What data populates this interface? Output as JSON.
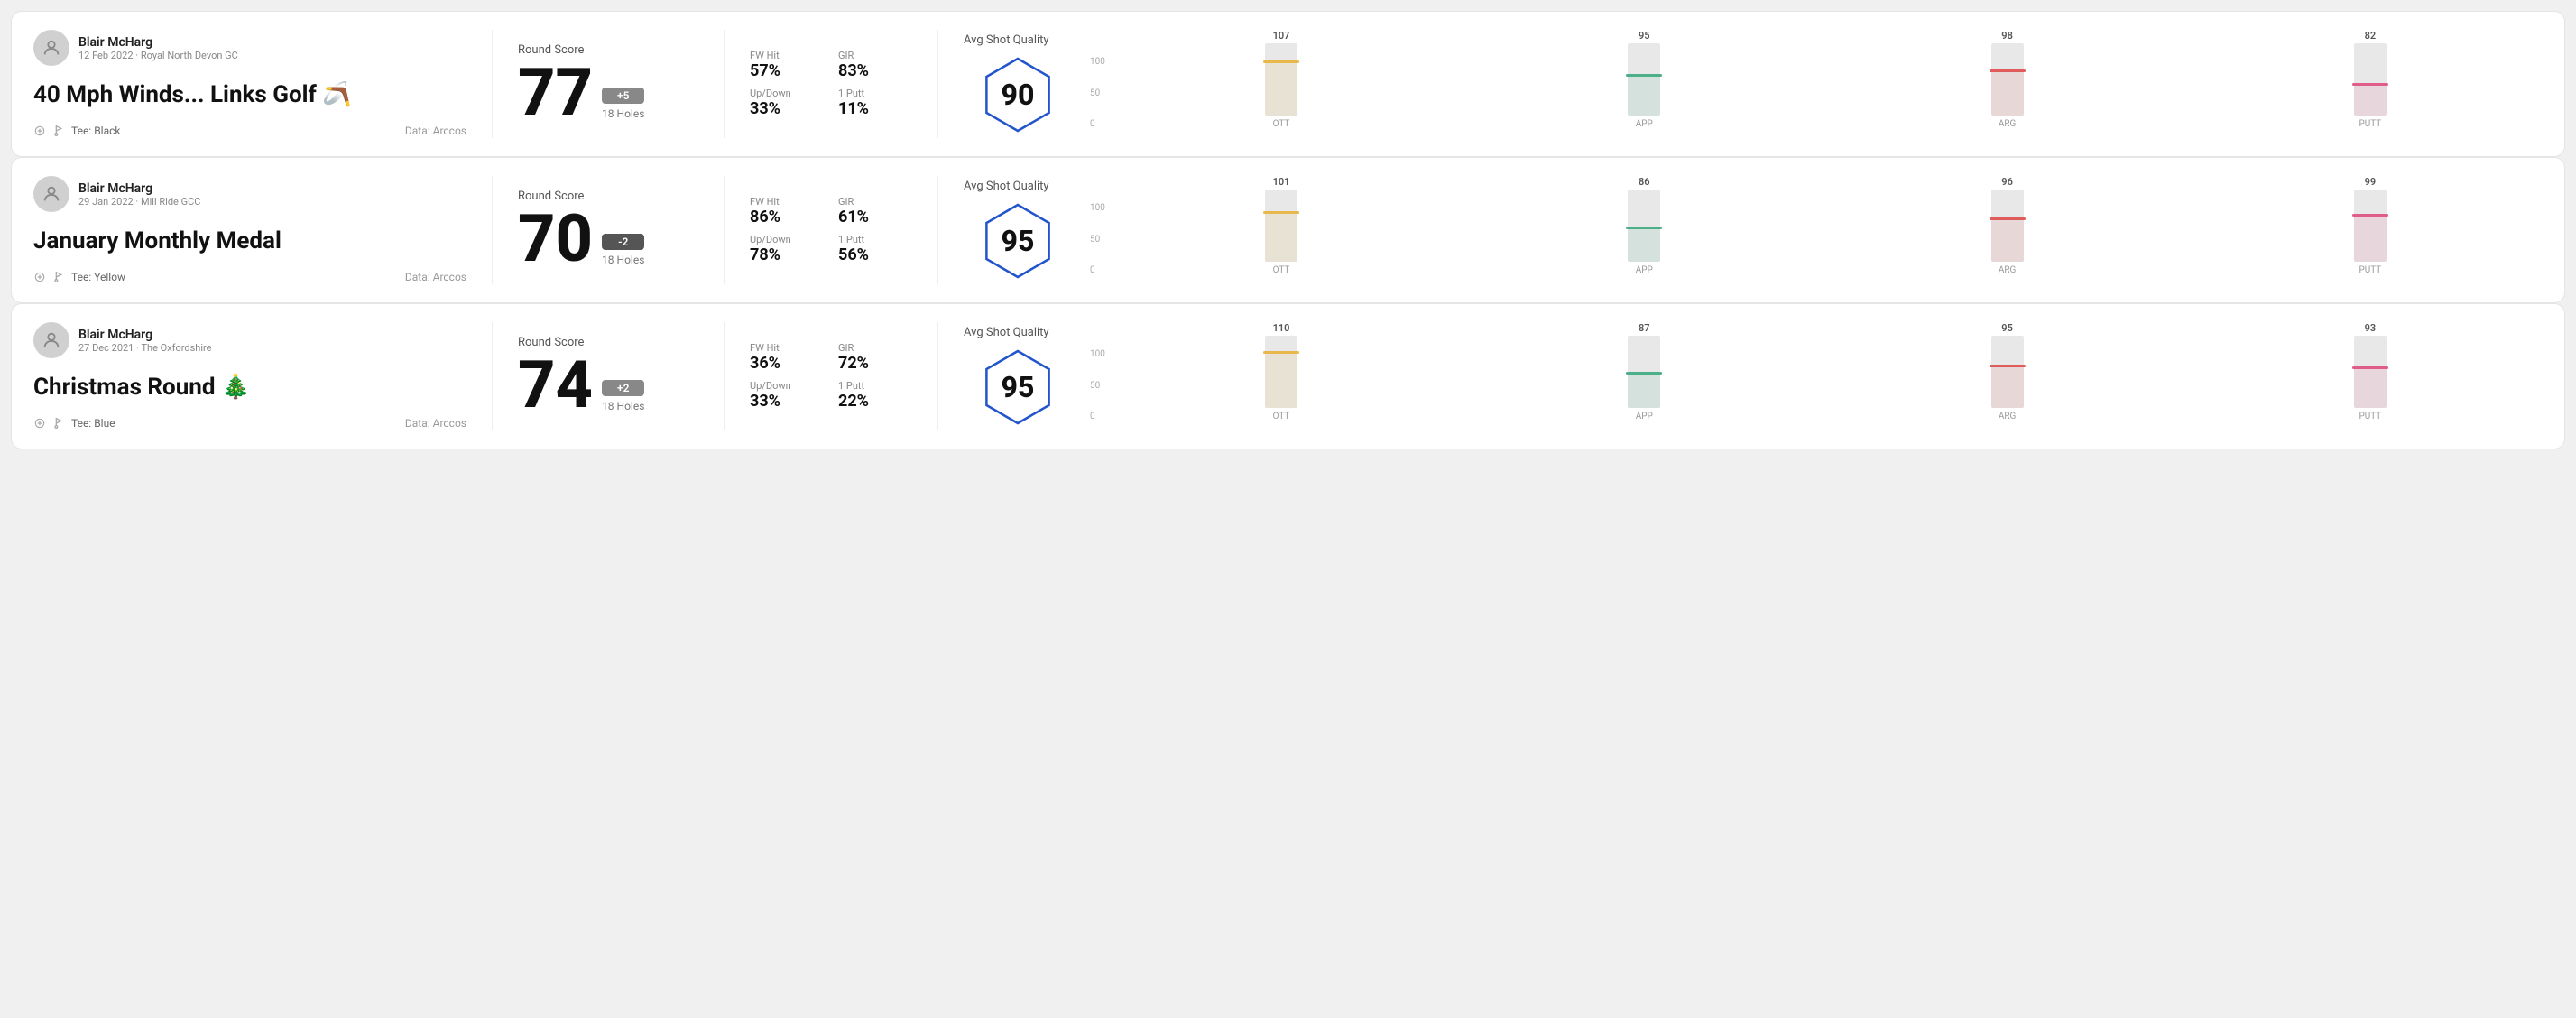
{
  "rounds": [
    {
      "id": "round1",
      "user": {
        "name": "Blair McHarg",
        "date": "12 Feb 2022 · Royal North Devon GC"
      },
      "title": "40 Mph Winds... Links Golf 🪃",
      "tee": "Black",
      "dataSource": "Data: Arccos",
      "score": {
        "label": "Round Score",
        "number": "77",
        "modifier": "+5",
        "modifierType": "positive",
        "holes": "18 Holes"
      },
      "stats": {
        "fwHitLabel": "FW Hit",
        "fwHitValue": "57%",
        "girLabel": "GIR",
        "girValue": "83%",
        "upDownLabel": "Up/Down",
        "upDownValue": "33%",
        "onePuttLabel": "1 Putt",
        "onePuttValue": "11%"
      },
      "quality": {
        "label": "Avg Shot Quality",
        "score": "90"
      },
      "chart": {
        "bars": [
          {
            "label": "OTT",
            "value": 107,
            "color": "#e8b84b",
            "fillHeight": 60
          },
          {
            "label": "APP",
            "value": 95,
            "color": "#4caf8a",
            "fillHeight": 45
          },
          {
            "label": "ARG",
            "value": 98,
            "color": "#e05c5c",
            "fillHeight": 50
          },
          {
            "label": "PUTT",
            "value": 82,
            "color": "#e05c8a",
            "fillHeight": 35
          }
        ]
      }
    },
    {
      "id": "round2",
      "user": {
        "name": "Blair McHarg",
        "date": "29 Jan 2022 · Mill Ride GCC"
      },
      "title": "January Monthly Medal",
      "tee": "Yellow",
      "dataSource": "Data: Arccos",
      "score": {
        "label": "Round Score",
        "number": "70",
        "modifier": "-2",
        "modifierType": "negative",
        "holes": "18 Holes"
      },
      "stats": {
        "fwHitLabel": "FW Hit",
        "fwHitValue": "86%",
        "girLabel": "GIR",
        "girValue": "61%",
        "upDownLabel": "Up/Down",
        "upDownValue": "78%",
        "onePuttLabel": "1 Putt",
        "onePuttValue": "56%"
      },
      "quality": {
        "label": "Avg Shot Quality",
        "score": "95"
      },
      "chart": {
        "bars": [
          {
            "label": "OTT",
            "value": 101,
            "color": "#e8b84b",
            "fillHeight": 55
          },
          {
            "label": "APP",
            "value": 86,
            "color": "#4caf8a",
            "fillHeight": 38
          },
          {
            "label": "ARG",
            "value": 96,
            "color": "#e05c5c",
            "fillHeight": 48
          },
          {
            "label": "PUTT",
            "value": 99,
            "color": "#e05c8a",
            "fillHeight": 52
          }
        ]
      }
    },
    {
      "id": "round3",
      "user": {
        "name": "Blair McHarg",
        "date": "27 Dec 2021 · The Oxfordshire"
      },
      "title": "Christmas Round 🎄",
      "tee": "Blue",
      "dataSource": "Data: Arccos",
      "score": {
        "label": "Round Score",
        "number": "74",
        "modifier": "+2",
        "modifierType": "positive",
        "holes": "18 Holes"
      },
      "stats": {
        "fwHitLabel": "FW Hit",
        "fwHitValue": "36%",
        "girLabel": "GIR",
        "girValue": "72%",
        "upDownLabel": "Up/Down",
        "upDownValue": "33%",
        "onePuttLabel": "1 Putt",
        "onePuttValue": "22%"
      },
      "quality": {
        "label": "Avg Shot Quality",
        "score": "95"
      },
      "chart": {
        "bars": [
          {
            "label": "OTT",
            "value": 110,
            "color": "#e8b84b",
            "fillHeight": 62
          },
          {
            "label": "APP",
            "value": 87,
            "color": "#4caf8a",
            "fillHeight": 39
          },
          {
            "label": "ARG",
            "value": 95,
            "color": "#e05c5c",
            "fillHeight": 47
          },
          {
            "label": "PUTT",
            "value": 93,
            "color": "#e05c8a",
            "fillHeight": 45
          }
        ]
      }
    }
  ]
}
